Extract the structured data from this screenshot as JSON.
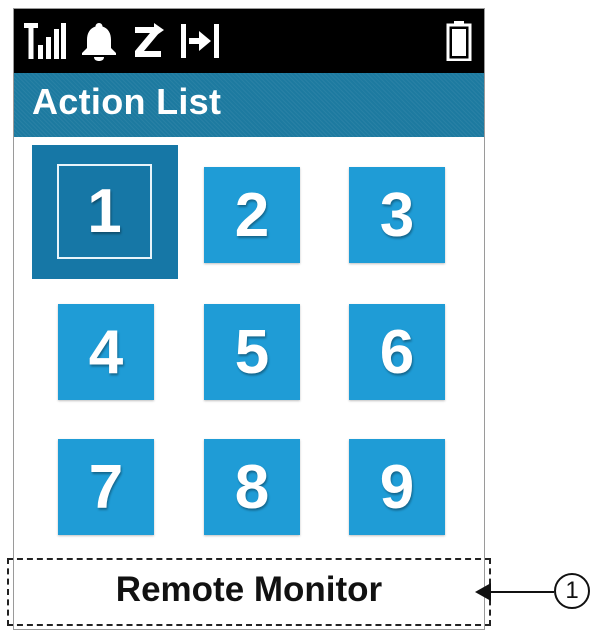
{
  "status_bar": {
    "icons": [
      "signal-strength-icon",
      "bell-icon",
      "scan-z-icon",
      "talkaround-icon",
      "battery-icon"
    ]
  },
  "title_bar": {
    "title": "Action List"
  },
  "grid": {
    "selected": "1",
    "items": [
      {
        "label": "1"
      },
      {
        "label": "2"
      },
      {
        "label": "3"
      },
      {
        "label": "4"
      },
      {
        "label": "5"
      },
      {
        "label": "6"
      },
      {
        "label": "7"
      },
      {
        "label": "8"
      },
      {
        "label": "9"
      }
    ]
  },
  "footer": {
    "label": "Remote Monitor"
  },
  "callout": {
    "number": "1"
  },
  "colors": {
    "tile": "#1f9cd6",
    "tile_selected": "#1677a6",
    "title_bar": "#1d7aa0",
    "status_bar": "#000000"
  }
}
